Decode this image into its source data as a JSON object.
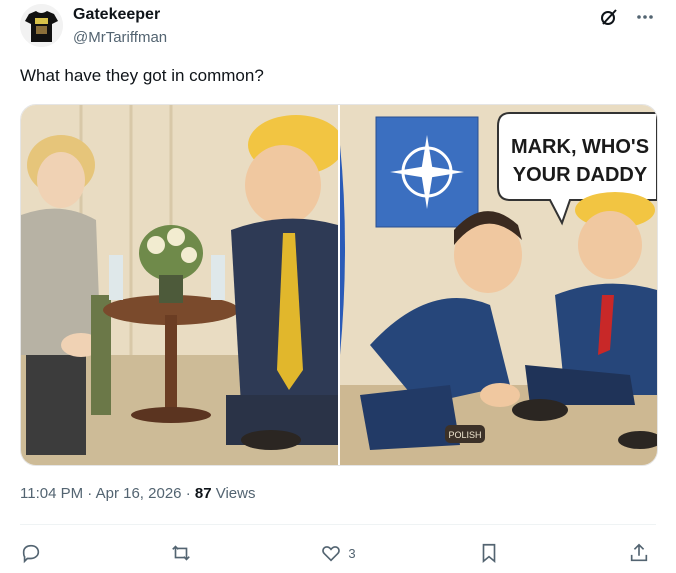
{
  "author": {
    "name": "Gatekeeper",
    "handle": "@MrTariffman"
  },
  "post": {
    "text": "What have they got in common?",
    "time": "11:04 PM",
    "date": "Apr 16, 2026",
    "views_count": "87",
    "views_label": "Views",
    "separator": "·"
  },
  "media": {
    "left_panel": {},
    "right_panel": {
      "speech_bubble": [
        "MARK, WHO'S",
        "YOUR DADDY"
      ],
      "tin_label": "POLISH"
    }
  },
  "actions": {
    "reply": "",
    "repost": "",
    "like": "3",
    "bookmark": "",
    "share": ""
  },
  "icons": {
    "top": [
      "grok-icon",
      "more-icon"
    ],
    "actions": [
      "reply-icon",
      "repost-icon",
      "like-icon",
      "bookmark-icon",
      "share-icon"
    ]
  }
}
